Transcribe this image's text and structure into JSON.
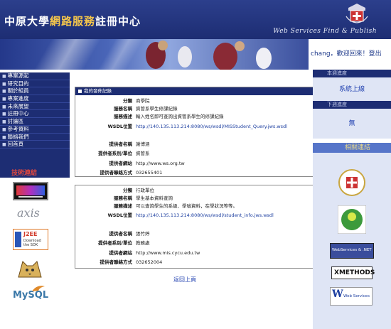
{
  "header": {
    "title_a": "中原大學",
    "title_b": "網路服務",
    "title_c": "註冊中心",
    "slogan": "Web Services Find & Publish"
  },
  "user": {
    "name": "chang",
    "welcome": "，歡迎回來！",
    "logout": "登出"
  },
  "nav": {
    "items": [
      "專案源起",
      "研究目的",
      "關於組員",
      "專案進度",
      "未來展望",
      "註冊中心",
      "討論區",
      "參考資料",
      "聯絡我們",
      "回首頁"
    ]
  },
  "tech": {
    "title": "技術連結",
    "axis_text": "axis",
    "j2ee_text": "J2EE",
    "j2ee_sub": "Download the SDK",
    "mysql_text": "MySQL"
  },
  "services": [
    {
      "header": "我的發佈記錄",
      "labels": {
        "category": "分類",
        "name": "服務名稱",
        "desc": "服務描述",
        "wsdl": "WSDL位置",
        "provider": "提供者名稱",
        "dept": "提供者系別/單位",
        "site": "提供者網站",
        "contact": "提供者聯絡方式"
      },
      "category": "商學院",
      "name": "資管系學生修課紀錄",
      "desc": "輸入姓名即可查詢出資管系學生的修課紀錄",
      "wsdl": "http://140.135.113.214:8080/ws/wsdl/MISStudent_Query.jws.wsdl",
      "provider": "謝博涵",
      "dept": "資管系",
      "site": "http://www.ws.org.tw",
      "contact": "032655401"
    },
    {
      "labels": {
        "category": "分類",
        "name": "服務名稱",
        "desc": "服務描述",
        "wsdl": "WSDL位置",
        "provider": "提供者名稱",
        "dept": "提供者系別/單位",
        "site": "提供者網站",
        "contact": "提供者聯絡方式"
      },
      "category": "行政單位",
      "name": "學生基本資料查詢",
      "desc": "可以查詢學生的系級、學號資料，在學狀況等等。",
      "wsdl": "http://140.135.113.214:8080/ws/wsdl/student_info.jws.wsdl",
      "provider": "張竹婷",
      "dept": "教務處",
      "site": "http://www.mis.cycu.edu.tw",
      "contact": "032652004"
    }
  ],
  "back_link": "返回上頁",
  "right": {
    "status_header": "本週進度",
    "status_value": "系統上線",
    "next_header": "下週進度",
    "next_value": "無",
    "links_title": "相關連結",
    "xmethods_text": "XMETHODS",
    "ws_text": "Web Services",
    "bell_text": "WebServices & .NET"
  },
  "colors": {
    "navy": "#1d2d73",
    "accent_yellow": "#f3c54c",
    "link_blue": "#2040b0",
    "panel_light": "#dfe5f5"
  }
}
